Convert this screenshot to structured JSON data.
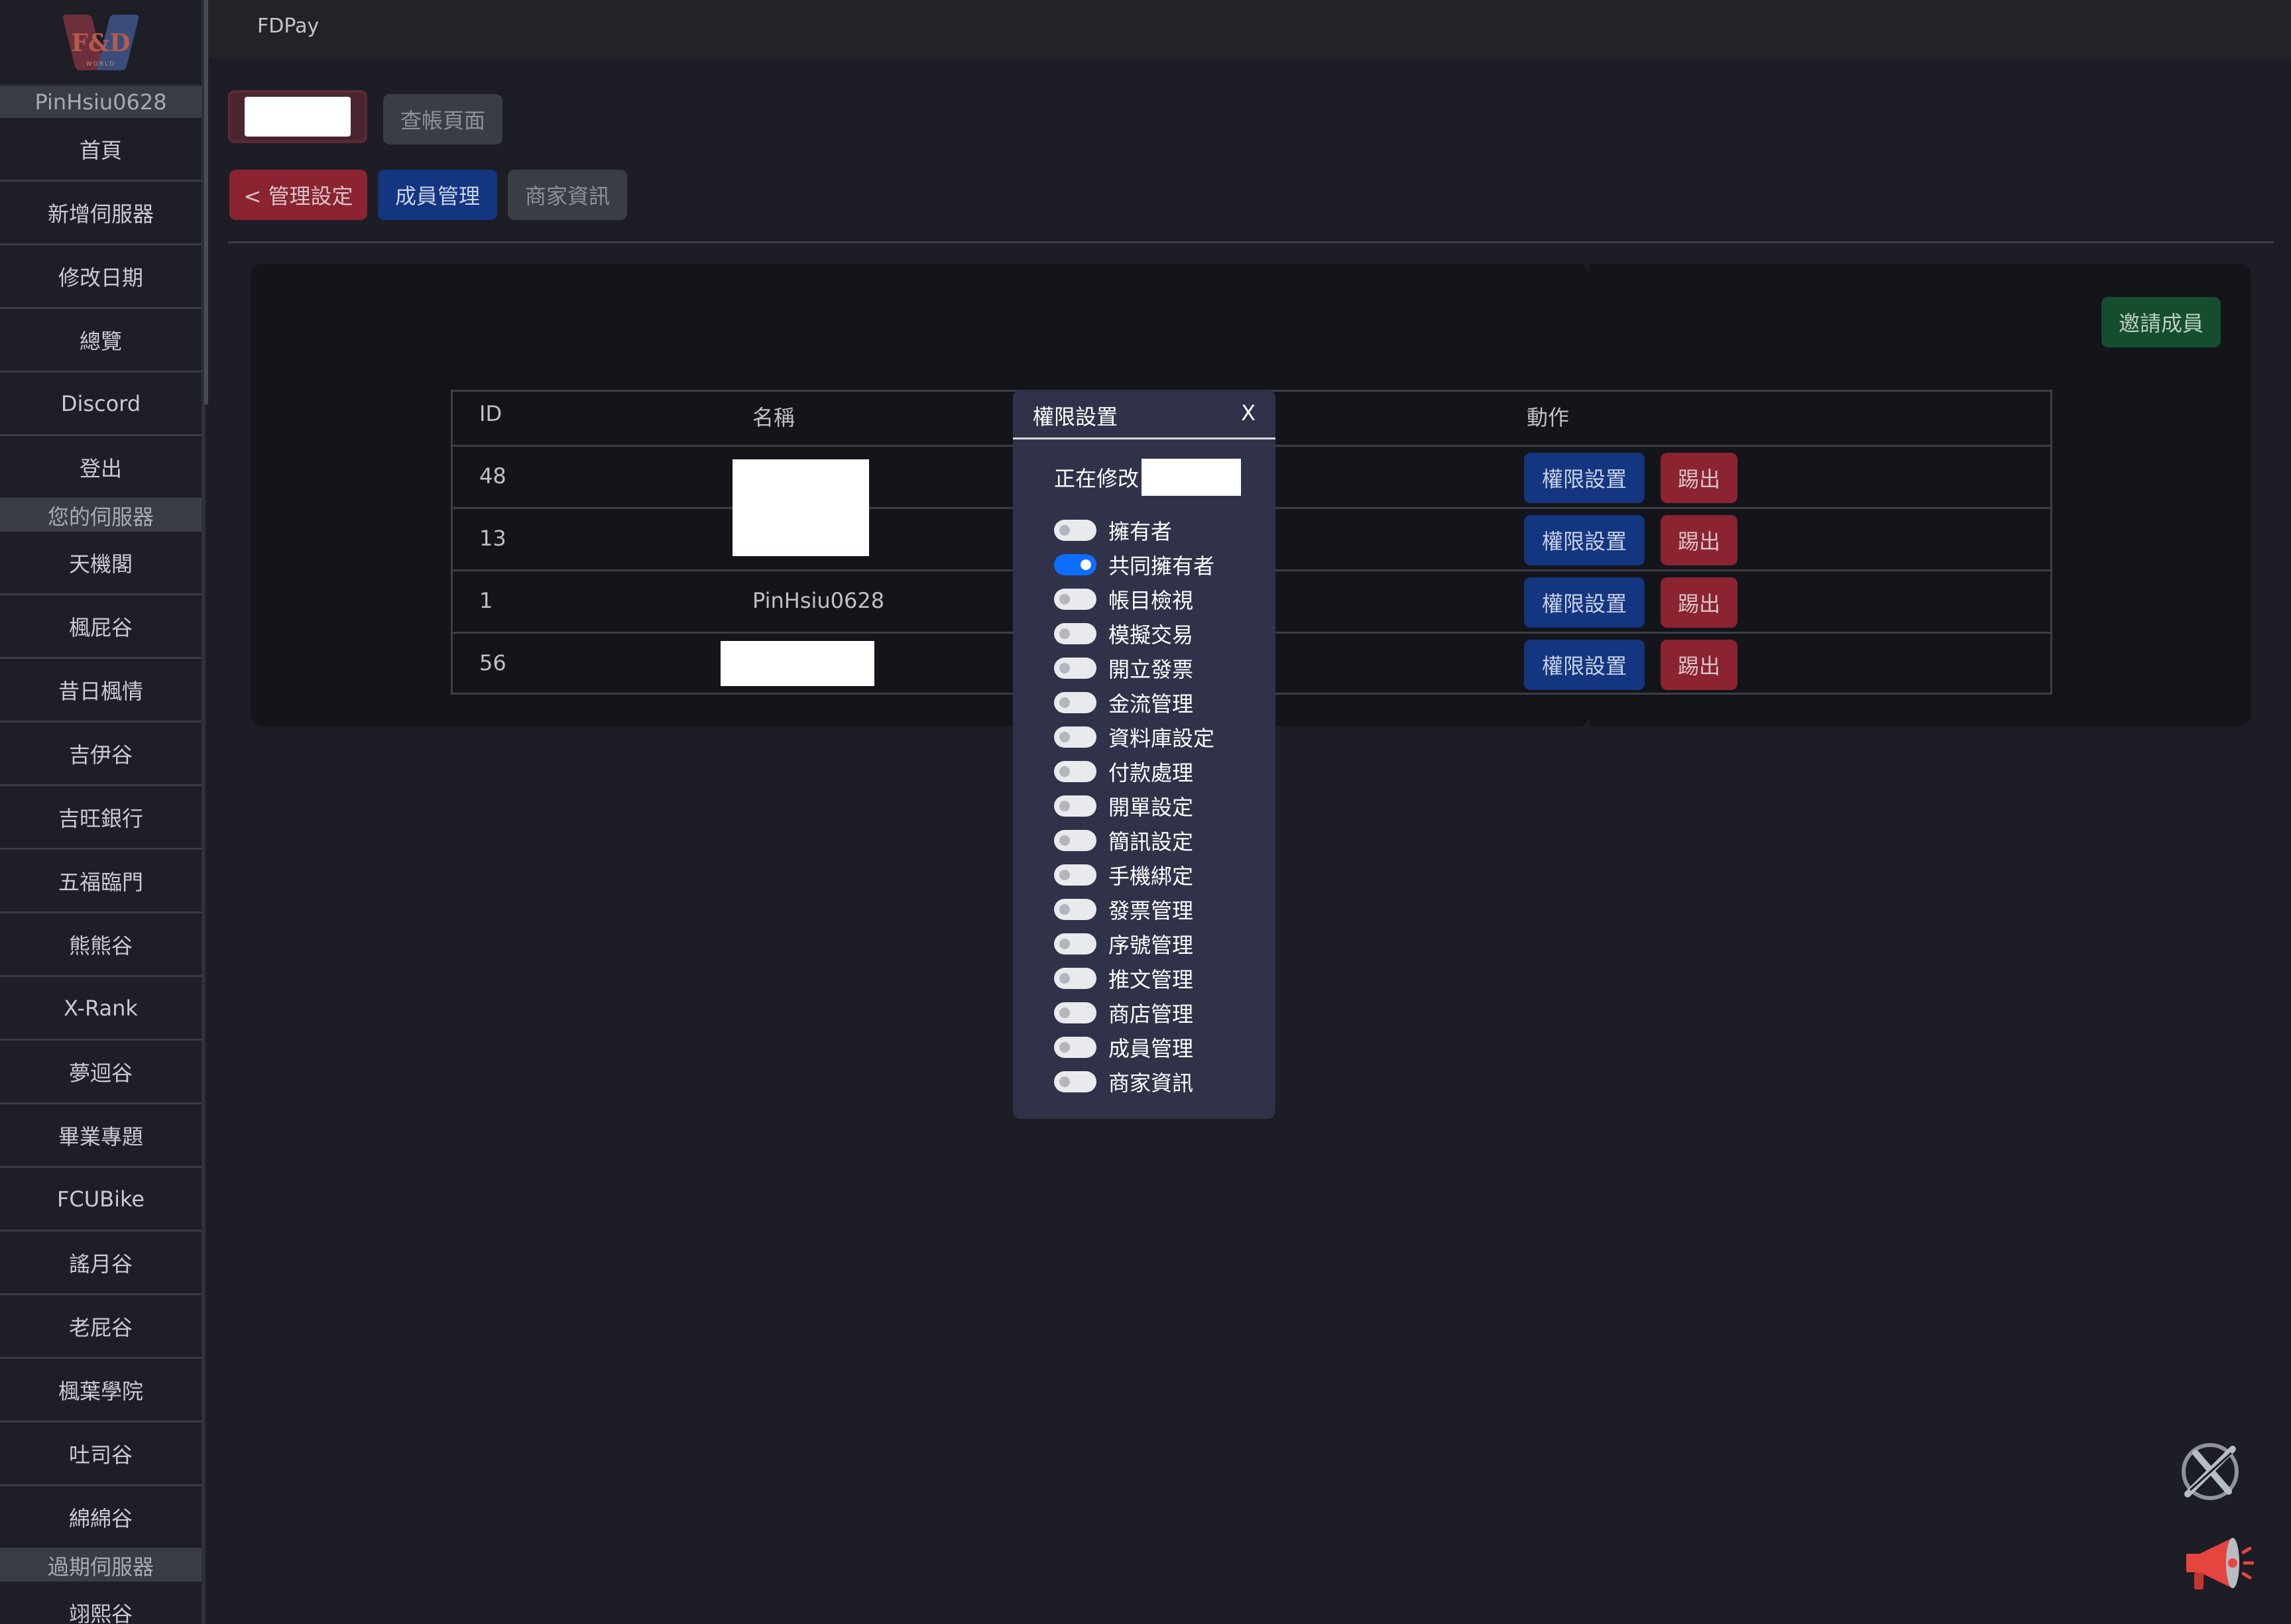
{
  "app": {
    "brand": "FDPay"
  },
  "logo": {
    "text": "F&D",
    "subtext": "WORLD"
  },
  "sidebar": {
    "username": "PinHsiu0628",
    "main_items": [
      "首頁",
      "新增伺服器",
      "修改日期",
      "總覽",
      "Discord",
      "登出"
    ],
    "servers_section": "您的伺服器",
    "servers": [
      "天機閣",
      "楓屁谷",
      "昔日楓情",
      "吉伊谷",
      "吉旺銀行",
      "五福臨門",
      "熊熊谷",
      "X-Rank",
      "夢迴谷",
      "畢業專題",
      "FCUBike",
      "謠月谷",
      "老屁谷",
      "楓葉學院",
      "吐司谷",
      "綿綿谷"
    ],
    "expired_section": "過期伺服器",
    "expired": [
      "翊熙谷"
    ]
  },
  "toolbar": {
    "check_accounts": "查帳頁面"
  },
  "tabs": {
    "back": "< 管理設定",
    "members": "成員管理",
    "merchant": "商家資訊"
  },
  "invite_button": "邀請成員",
  "table": {
    "headers": {
      "id": "ID",
      "name": "名稱",
      "action": "動作"
    },
    "rows": [
      {
        "id": "48",
        "name": ""
      },
      {
        "id": "13",
        "name": ""
      },
      {
        "id": "1",
        "name": "PinHsiu0628"
      },
      {
        "id": "56",
        "name": ""
      }
    ],
    "permission_label": "權限設置",
    "kick_label": "踢出"
  },
  "modal": {
    "title": "權限設置",
    "close": "X",
    "editing_label": "正在修改",
    "permissions": [
      {
        "label": "擁有者",
        "on": false
      },
      {
        "label": "共同擁有者",
        "on": true
      },
      {
        "label": "帳目檢視",
        "on": false
      },
      {
        "label": "模擬交易",
        "on": false
      },
      {
        "label": "開立發票",
        "on": false
      },
      {
        "label": "金流管理",
        "on": false
      },
      {
        "label": "資料庫設定",
        "on": false
      },
      {
        "label": "付款處理",
        "on": false
      },
      {
        "label": "開單設定",
        "on": false
      },
      {
        "label": "簡訊設定",
        "on": false
      },
      {
        "label": "手機綁定",
        "on": false
      },
      {
        "label": "發票管理",
        "on": false
      },
      {
        "label": "序號管理",
        "on": false
      },
      {
        "label": "推文管理",
        "on": false
      },
      {
        "label": "商店管理",
        "on": false
      },
      {
        "label": "成員管理",
        "on": false
      },
      {
        "label": "商家資訊",
        "on": false
      }
    ]
  },
  "colors": {
    "toggle_on": "#0d6efd",
    "primary": "#14357f",
    "danger": "#8b2330",
    "success": "#154d2e"
  },
  "icons": {
    "x_fab": "x-logo-icon",
    "announce": "megaphone-icon"
  }
}
